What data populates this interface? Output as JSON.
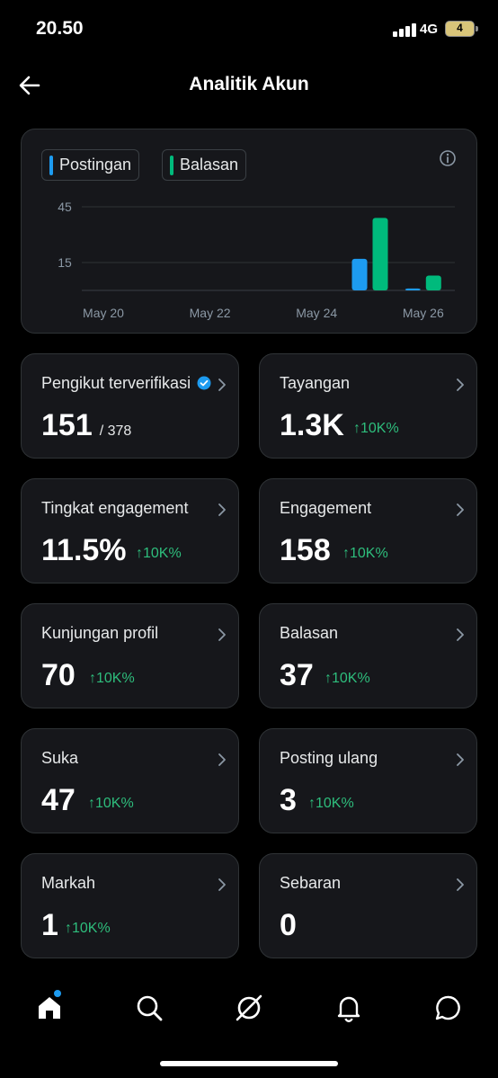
{
  "status_bar": {
    "time": "20.50",
    "network": "4G",
    "battery": "4"
  },
  "header": {
    "title": "Analitik Akun"
  },
  "chart": {
    "legend": [
      {
        "label": "Postingan",
        "color": "#1d9bf0"
      },
      {
        "label": "Balasan",
        "color": "#00ba7c"
      }
    ]
  },
  "chart_data": {
    "type": "bar",
    "categories": [
      "May 20",
      "May 21",
      "May 22",
      "May 23",
      "May 24",
      "May 25",
      "May 26"
    ],
    "x_tick_labels": [
      "May 20",
      "May 22",
      "May 24",
      "May 26"
    ],
    "y_tick_labels": [
      "45",
      "15"
    ],
    "yticks": [
      45,
      15
    ],
    "ylim": [
      0,
      45
    ],
    "series": [
      {
        "name": "Postingan",
        "color": "#1d9bf0",
        "values": [
          0,
          0,
          0,
          0,
          0,
          17,
          1
        ]
      },
      {
        "name": "Balasan",
        "color": "#00ba7c",
        "values": [
          0,
          0,
          0,
          0,
          0,
          39,
          8
        ]
      }
    ],
    "grid": true,
    "legend_position": "top-left"
  },
  "stats": [
    {
      "label": "Pengikut terverifikasi",
      "value": "151",
      "sub": "/ 378",
      "change": "",
      "verified": true
    },
    {
      "label": "Tayangan",
      "value": "1.3K",
      "sub": "",
      "change": "↑10K%"
    },
    {
      "label": "Tingkat engagement",
      "value": "11.5%",
      "sub": "",
      "change": "↑10K%"
    },
    {
      "label": "Engagement",
      "value": "158",
      "sub": "",
      "change": "↑10K%"
    },
    {
      "label": "Kunjungan profil",
      "value": "70",
      "sub": "",
      "change": "↑10K%"
    },
    {
      "label": "Balasan",
      "value": "37",
      "sub": "",
      "change": "↑10K%"
    },
    {
      "label": "Suka",
      "value": "47",
      "sub": "",
      "change": "↑10K%"
    },
    {
      "label": "Posting ulang",
      "value": "3",
      "sub": "",
      "change": "↑10K%"
    },
    {
      "label": "Markah",
      "value": "1",
      "sub": "",
      "change": "↑10K%"
    },
    {
      "label": "Sebaran",
      "value": "0",
      "sub": "",
      "change": ""
    }
  ],
  "nav": {
    "items": [
      "home-icon",
      "search-icon",
      "grok-icon",
      "bell-icon",
      "messages-icon"
    ],
    "accent": "#1d9bf0"
  }
}
